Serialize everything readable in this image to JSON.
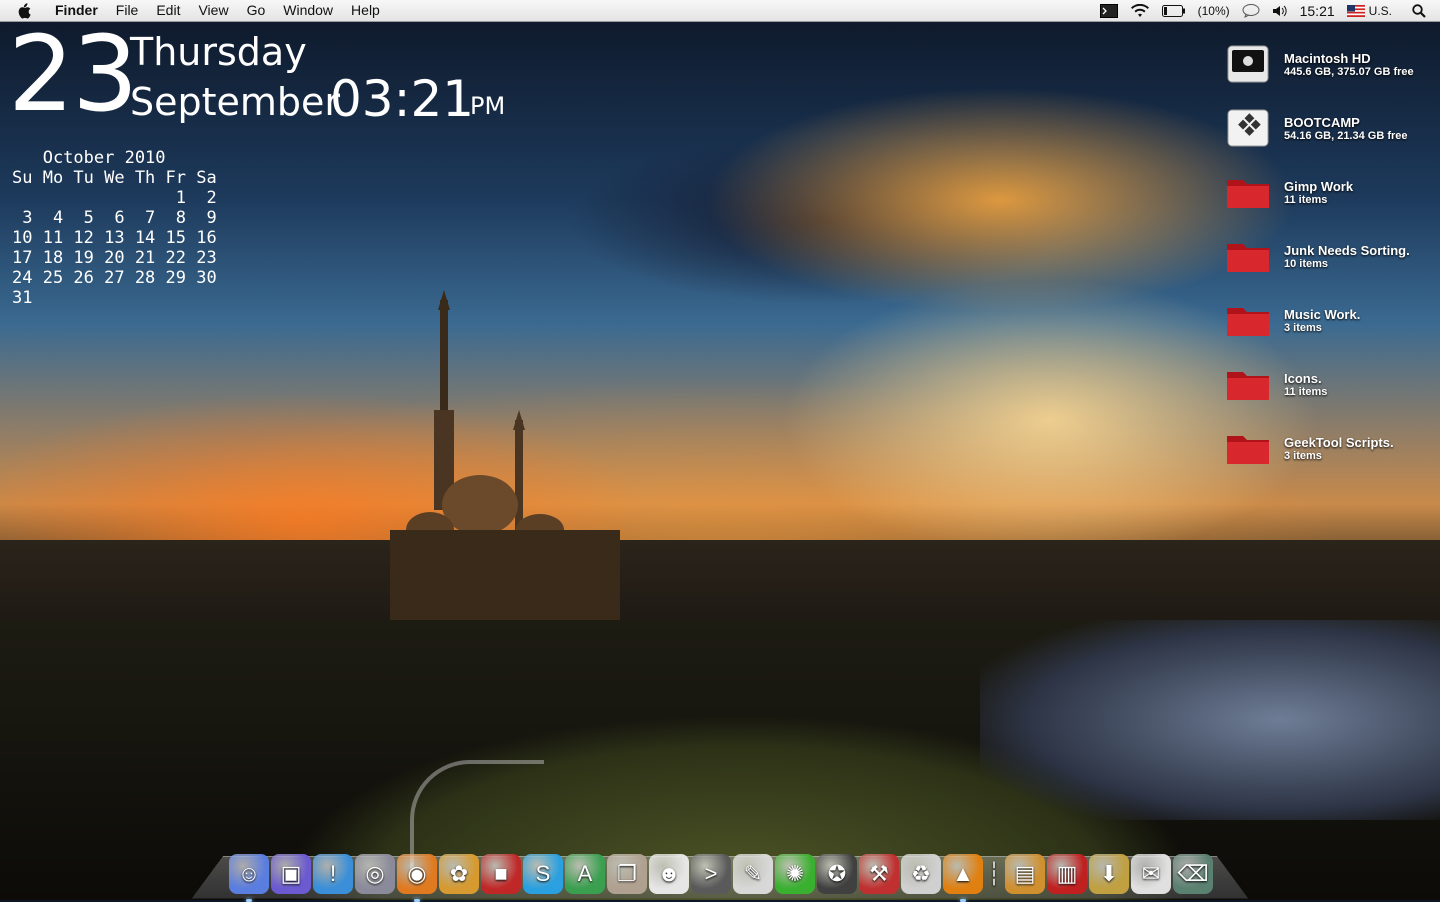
{
  "menubar": {
    "items": [
      "Finder",
      "File",
      "Edit",
      "View",
      "Go",
      "Window",
      "Help"
    ],
    "battery": "(10%)",
    "clock": "15:21",
    "input_source": "U.S."
  },
  "clock_widget": {
    "day": "23",
    "weekday": "Thursday",
    "month": "September",
    "time": "03:21",
    "ampm": "PM"
  },
  "calendar": {
    "text": "   October 2010\nSu Mo Tu We Th Fr Sa\n                1  2\n 3  4  5  6  7  8  9\n10 11 12 13 14 15 16\n17 18 19 20 21 22 23\n24 25 26 27 28 29 30\n31"
  },
  "desktop_items": [
    {
      "name": "Macintosh HD",
      "sub": "445.6 GB, 375.07 GB free",
      "icon": "hard-drive-icon"
    },
    {
      "name": "BOOTCAMP",
      "sub": "54.16 GB, 21.34 GB free",
      "icon": "windows-drive-icon"
    },
    {
      "name": "Gimp Work",
      "sub": "11 items",
      "icon": "red-folder-icon"
    },
    {
      "name": "Junk Needs Sorting.",
      "sub": "10 items",
      "icon": "red-folder-icon"
    },
    {
      "name": "Music Work.",
      "sub": "3 items",
      "icon": "red-folder-icon"
    },
    {
      "name": "Icons.",
      "sub": "11 items",
      "icon": "red-folder-icon"
    },
    {
      "name": "GeekTool Scripts.",
      "sub": "3 items",
      "icon": "red-folder-icon"
    }
  ],
  "dock": [
    {
      "icon": "finder-icon",
      "glyph": "☺",
      "color": "#5a7de0",
      "running": true
    },
    {
      "icon": "photo-frame-icon",
      "glyph": "▣",
      "color": "#6b5ad0",
      "running": false
    },
    {
      "icon": "adium-icon",
      "glyph": "!",
      "color": "#3a8fd8",
      "running": false
    },
    {
      "icon": "dvd-icon",
      "glyph": "◎",
      "color": "#8a8a9a",
      "running": false
    },
    {
      "icon": "firefox-icon",
      "glyph": "◉",
      "color": "#e07a20",
      "running": true
    },
    {
      "icon": "iphoto-icon",
      "glyph": "✿",
      "color": "#d69a30",
      "running": false
    },
    {
      "icon": "photo-booth-icon",
      "glyph": "■",
      "color": "#c02828",
      "running": false
    },
    {
      "icon": "skype-icon",
      "glyph": "S",
      "color": "#2aa0e0",
      "running": false
    },
    {
      "icon": "app-store-icon",
      "glyph": "A",
      "color": "#3aa050",
      "running": false
    },
    {
      "icon": "preview-icon",
      "glyph": "❐",
      "color": "#b0a090",
      "running": false
    },
    {
      "icon": "anonymous-mask-icon",
      "glyph": "☻",
      "color": "#e6e6e6",
      "running": false
    },
    {
      "icon": "terminal-icon",
      "glyph": ">",
      "color": "#5a5a5a",
      "running": false
    },
    {
      "icon": "textedit-icon",
      "glyph": "✎",
      "color": "#d8d8d8",
      "running": false
    },
    {
      "icon": "limewire-icon",
      "glyph": "✺",
      "color": "#3ab030",
      "running": false
    },
    {
      "icon": "safari-icon",
      "glyph": "✪",
      "color": "#404040",
      "running": false
    },
    {
      "icon": "utility-icon",
      "glyph": "⚒",
      "color": "#c03030",
      "running": false
    },
    {
      "icon": "recycle-icon",
      "glyph": "♻",
      "color": "#d0d0d0",
      "running": false
    },
    {
      "icon": "vlc-icon",
      "glyph": "▲",
      "color": "#e08010",
      "running": true
    },
    {
      "icon": "separator-icon",
      "glyph": "┆",
      "color": "transparent",
      "running": false
    },
    {
      "icon": "documents-stack-icon",
      "glyph": "▤",
      "color": "#d09030",
      "running": false
    },
    {
      "icon": "pdf-stack-icon",
      "glyph": "▥",
      "color": "#c02020",
      "running": false
    },
    {
      "icon": "downloads-folder-icon",
      "glyph": "⬇",
      "color": "#c0a040",
      "running": false
    },
    {
      "icon": "mail-icon",
      "glyph": "✉",
      "color": "#e0e0e0",
      "running": false
    },
    {
      "icon": "trash-icon",
      "glyph": "⌫",
      "color": "#5a8070",
      "running": false
    }
  ]
}
